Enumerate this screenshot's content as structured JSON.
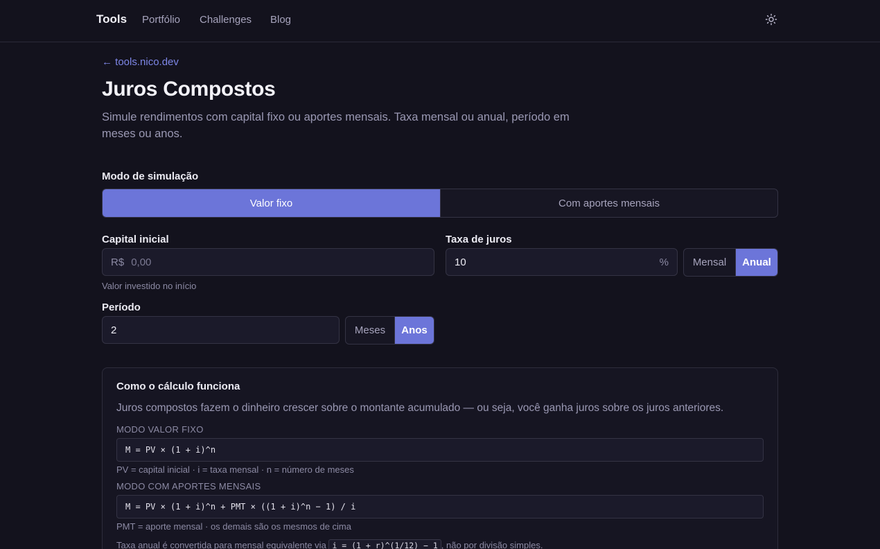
{
  "nav": {
    "brand": "Tools",
    "links": [
      "Portfólio",
      "Challenges",
      "Blog"
    ],
    "theme_icon": "sun-icon"
  },
  "header": {
    "back_label": "← tools.nico.dev",
    "title": "Juros Compostos",
    "subtitle": "Simule rendimentos com capital fixo ou aportes mensais. Taxa mensal ou anual, período em meses ou anos."
  },
  "mode": {
    "label": "Modo de simulação",
    "options": [
      "Valor fixo",
      "Com aportes mensais"
    ],
    "selected": "Valor fixo"
  },
  "capital": {
    "label": "Capital inicial",
    "prefix": "R$",
    "placeholder": "0,00",
    "value": "",
    "hint": "Valor investido no início"
  },
  "rate": {
    "label": "Taxa de juros",
    "value": "10",
    "suffix": "%",
    "units": [
      "Mensal",
      "Anual"
    ],
    "selected_unit": "Anual"
  },
  "period": {
    "label": "Período",
    "value": "2",
    "units": [
      "Meses",
      "Anos"
    ],
    "selected_unit": "Anos"
  },
  "explain": {
    "title": "Como o cálculo funciona",
    "intro": "Juros compostos fazem o dinheiro crescer sobre o montante acumulado — ou seja, você ganha juros sobre os juros anteriores.",
    "fixed_label": "Modo valor fixo",
    "fixed_formula": "M = PV × (1 + i)^n",
    "fixed_note": "PV = capital inicial · i = taxa mensal · n = número de meses",
    "monthly_label": "Modo com aportes mensais",
    "monthly_formula": "M = PV × (1 + i)^n + PMT × ((1 + i)^n − 1) / i",
    "monthly_note": "PMT = aporte mensal · os demais são os mesmos de cima",
    "conversion_prefix": "Taxa anual é convertida para mensal equivalente via",
    "conversion_code": "i = (1 + r)^(1/12) − 1",
    "conversion_suffix": ", não por divisão simples."
  }
}
